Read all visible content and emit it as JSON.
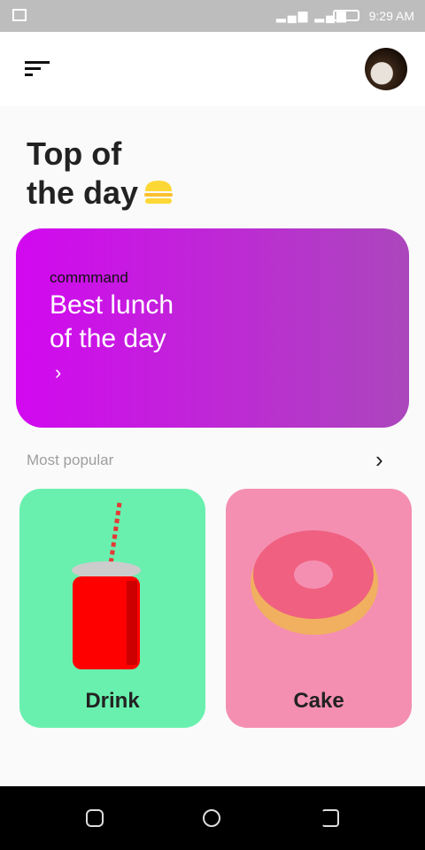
{
  "status": {
    "time": "9:29 AM"
  },
  "header": {
    "title_line1": "Top of",
    "title_line2": "the day"
  },
  "hero": {
    "subtitle": "commmand",
    "title_line1": "Best lunch",
    "title_line2": "of the day"
  },
  "section": {
    "label": "Most popular"
  },
  "cards": [
    {
      "label": "Drink",
      "color": "#69f0ae"
    },
    {
      "label": "Cake",
      "color": "#f48fb1"
    }
  ]
}
